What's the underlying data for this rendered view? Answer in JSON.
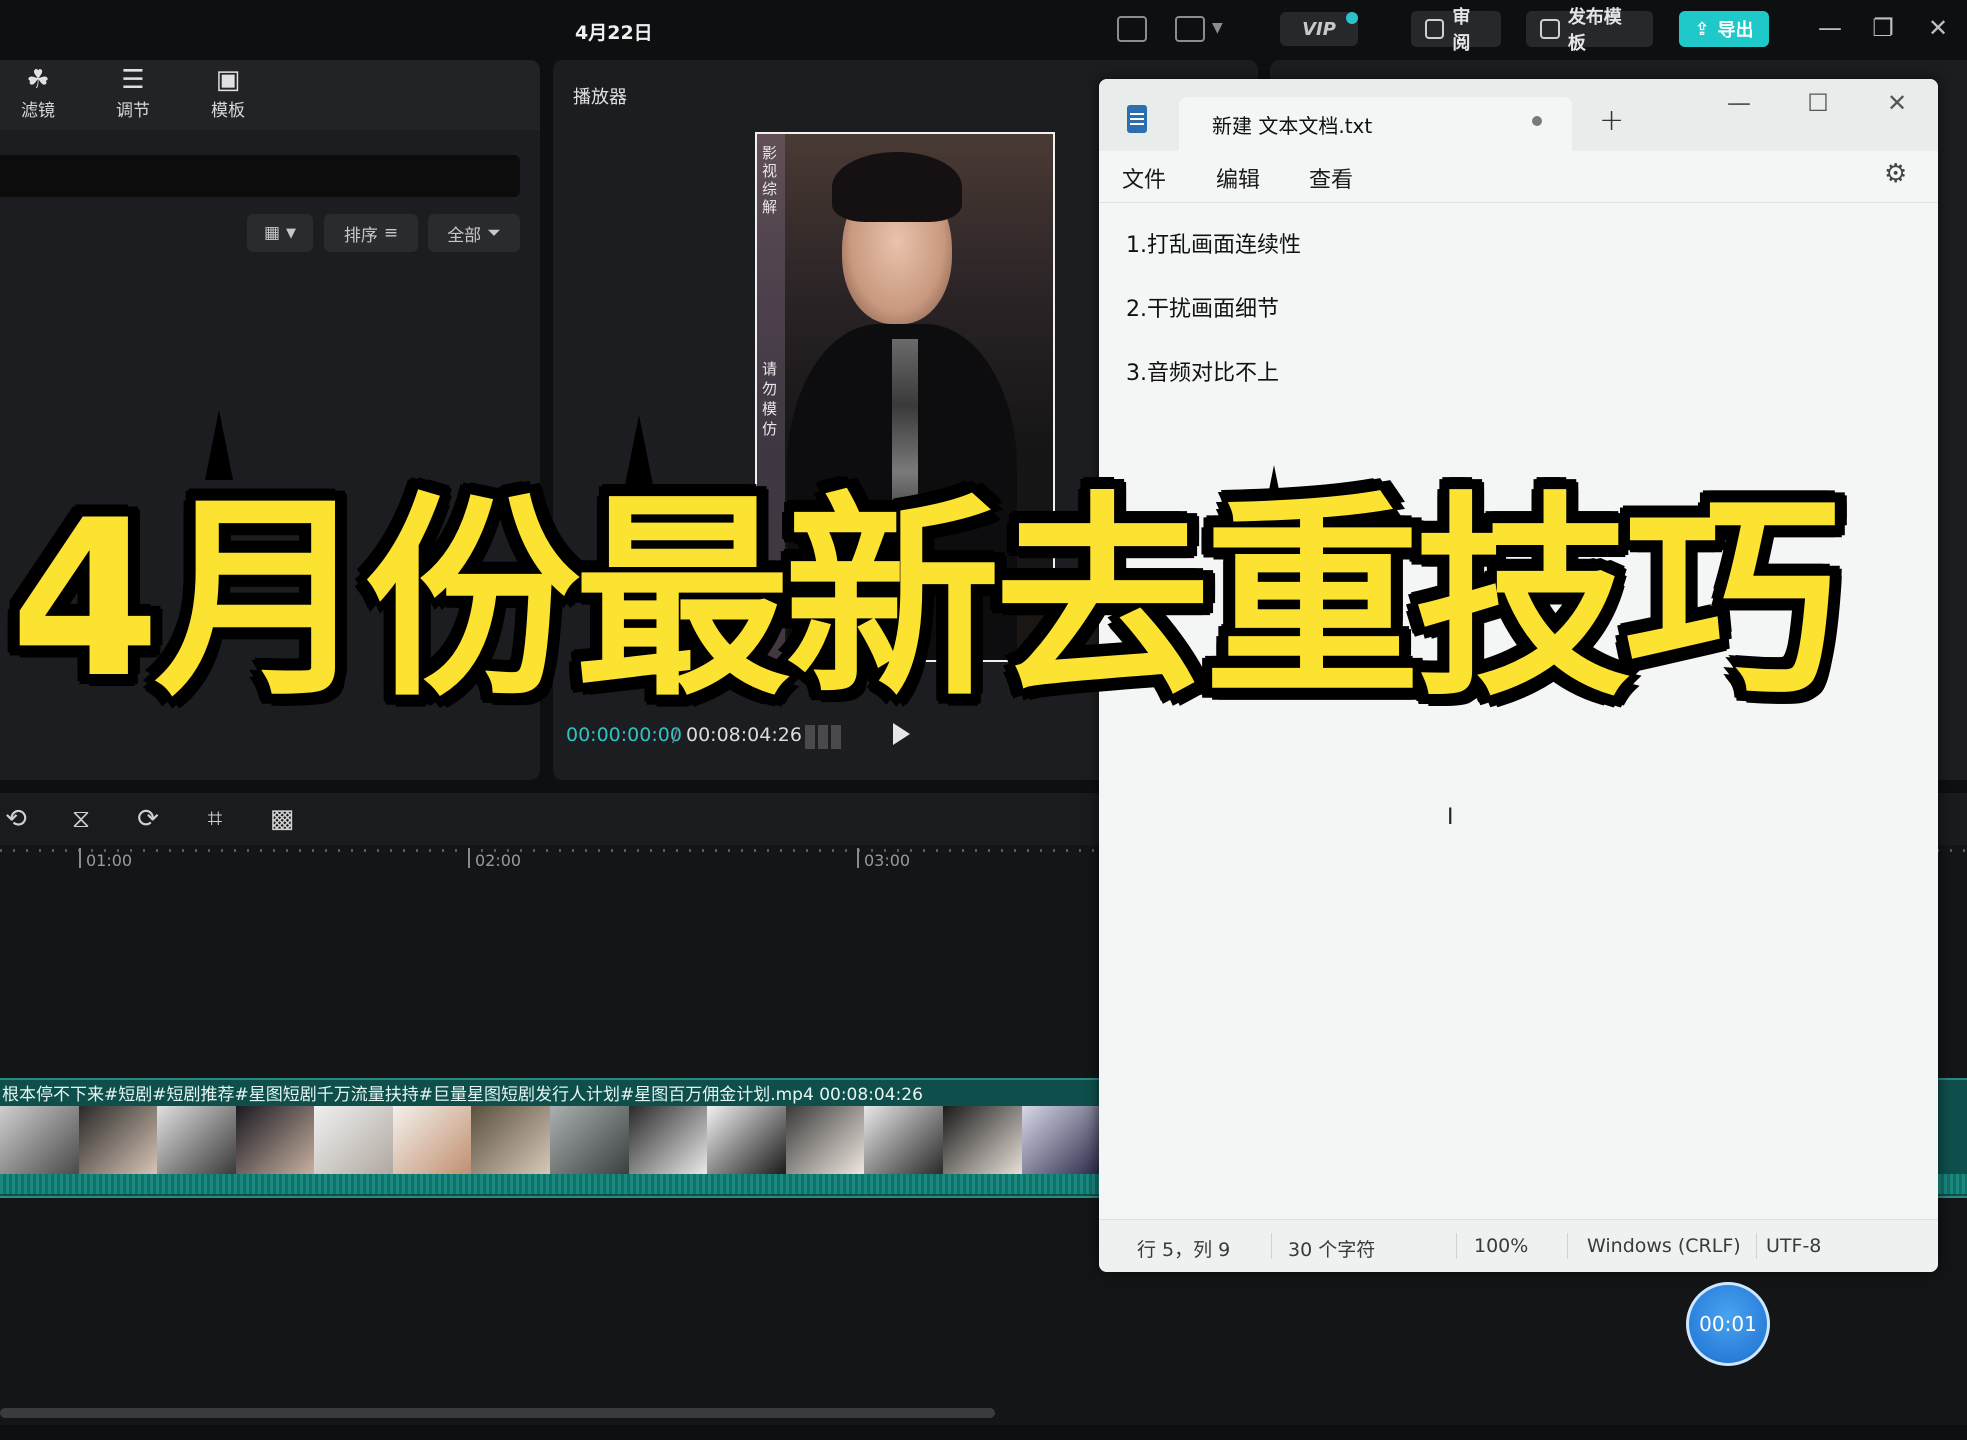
{
  "topbar": {
    "title": "4月22日",
    "vip_label": "VIP",
    "review_label": "审阅",
    "publish_template_label": "发布模板",
    "export_label": "导出"
  },
  "media_panel": {
    "toolbar": [
      {
        "icon": "filter-icon",
        "label": "滤镜"
      },
      {
        "icon": "adjust-icon",
        "label": "调节"
      },
      {
        "icon": "template-icon",
        "label": "模板"
      }
    ],
    "sort_label": "排序",
    "all_label": "全部"
  },
  "player": {
    "title": "播放器",
    "time_current": "00:00:00:00",
    "time_separator": "/",
    "time_total": "00:08:04:26",
    "watermark_top": "影视综解",
    "watermark_bottom": "请勿模仿"
  },
  "timeline": {
    "ruler_labels": [
      "01:00",
      "02:00",
      "03:00"
    ],
    "clip_title": "根本停不下来#短剧#短剧推荐#星图短剧千万流量扶持#巨量星图短剧发行人计划#星图百万佣金计划.mp4   00:08:04:26"
  },
  "notepad": {
    "tab_title": "新建 文本文档.txt",
    "new_tab": "+",
    "menu": [
      "文件",
      "编辑",
      "查看"
    ],
    "lines": [
      "1.打乱画面连续性",
      "2.干扰画面细节",
      "3.音频对比不上"
    ],
    "status": {
      "position": "行 5，列 9",
      "chars": "30 个字符",
      "zoom": "100%",
      "line_ending": "Windows (CRLF)",
      "encoding": "UTF-8"
    }
  },
  "recorder": {
    "time": "00:01"
  },
  "overlay": {
    "title": "4月份最新去重技巧",
    "color": "#fde331"
  },
  "colors": {
    "accent": "#1fc9c9",
    "timecode": "#2ec4c6",
    "clip_track": "#0f4f4b"
  }
}
